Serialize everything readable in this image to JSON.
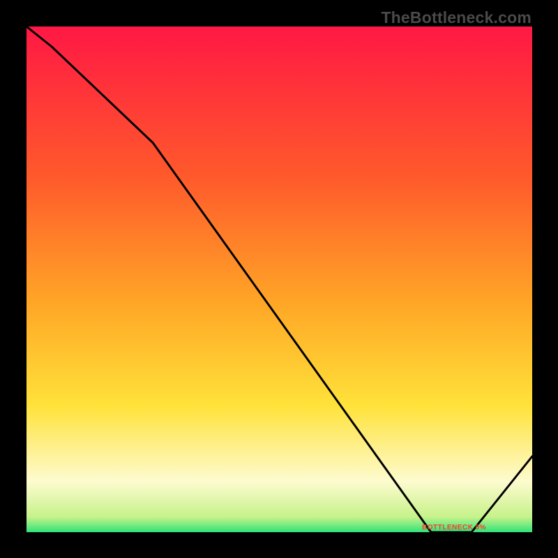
{
  "watermark": "TheBottleneck.com",
  "label_text": "BOTTLENECK 0%",
  "colors": {
    "top": "#ff1844",
    "mid_red": "#ff5a2b",
    "orange": "#ffa726",
    "yellow": "#ffe23a",
    "pale": "#fdfbcf",
    "green": "#2ee37a",
    "line": "#000000",
    "frame": "#000000",
    "watermark": "#4a4a4a",
    "label": "#ff3a2a"
  },
  "chart_data": {
    "type": "line",
    "title": "",
    "xlabel": "",
    "ylabel": "",
    "xlim": [
      0,
      100
    ],
    "ylim": [
      0,
      100
    ],
    "x": [
      0,
      5,
      25,
      80,
      88,
      100
    ],
    "y": [
      100,
      96,
      77,
      0,
      0,
      15
    ],
    "gradient_stops": [
      {
        "pos": 0.0,
        "color": "#ff1844"
      },
      {
        "pos": 0.3,
        "color": "#ff5a2b"
      },
      {
        "pos": 0.55,
        "color": "#ffa726"
      },
      {
        "pos": 0.75,
        "color": "#ffe23a"
      },
      {
        "pos": 0.9,
        "color": "#fdfbcf"
      },
      {
        "pos": 0.97,
        "color": "#c7f28a"
      },
      {
        "pos": 1.0,
        "color": "#2ee37a"
      }
    ],
    "bottleneck_band": {
      "x0": 80,
      "x1": 88,
      "y": 0
    }
  }
}
